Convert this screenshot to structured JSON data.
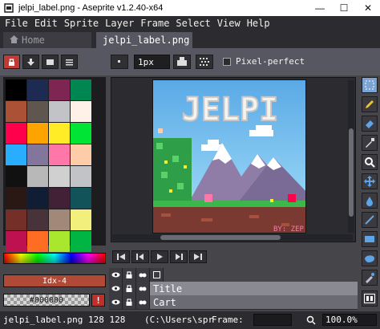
{
  "window": {
    "title": "jelpi_label.png - Aseprite v1.2.40-x64",
    "minimize": "—",
    "maximize": "☐",
    "close": "✕"
  },
  "menu": [
    "File",
    "Edit",
    "Sprite",
    "Layer",
    "Frame",
    "Select",
    "View",
    "Help"
  ],
  "tabs": {
    "home": "Home",
    "active": "jelpi_label.png"
  },
  "contextbar": {
    "brush_size": "1px",
    "pixel_perfect_label": "Pixel-perfect",
    "pixel_perfect_checked": false
  },
  "palette": {
    "swatches": [
      "#000000",
      "#1d2b53",
      "#7e2553",
      "#008751",
      "#ab5236",
      "#5f574f",
      "#c2c3c7",
      "#fff1e8",
      "#ff004d",
      "#ffa300",
      "#ffec27",
      "#00e436",
      "#29adff",
      "#83769c",
      "#ff77a8",
      "#ffccaa",
      "#111111",
      "#b8b8b8",
      "#d0d0d0",
      "#c2c3c7",
      "#291814",
      "#111d35",
      "#422136",
      "#125359",
      "#742f29",
      "#49333b",
      "#a28879",
      "#f3ef7d",
      "#be1250",
      "#ff6c24",
      "#a8e72e",
      "#00b543"
    ],
    "foreground_index": "Idx-4",
    "background_hex": "#000000",
    "warning_icon": "!"
  },
  "sprite": {
    "title_text": "JELPI",
    "credit_text": "BY: ZEP"
  },
  "layers": [
    {
      "name": "Title",
      "selected": true
    },
    {
      "name": "Cart",
      "selected": false
    }
  ],
  "statusbar": {
    "filename": "jelpi_label.png",
    "size": "128 128",
    "path": "(C:\\Users\\spr",
    "frame_label": "Frame:",
    "zoom": "100.0%"
  },
  "colors": {
    "accent_red": "#c0302a",
    "selected_tool": "#7aa4d4"
  }
}
